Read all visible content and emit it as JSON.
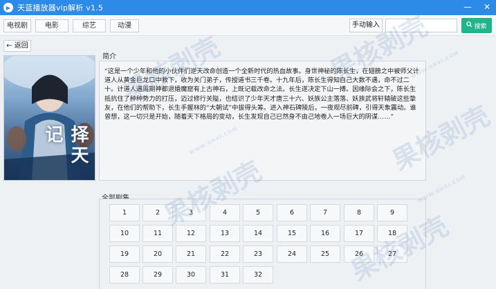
{
  "window": {
    "title": "天蓝播放器vip解析  v1.5",
    "minimize_glyph": "—",
    "close_glyph": "✕"
  },
  "toolbar": {
    "categories": [
      "电视剧",
      "电影",
      "综艺",
      "动漫"
    ],
    "manual_input_label": "手动输入",
    "search_value": "",
    "search_button_label": "搜索",
    "search_button_color": "#1fb489"
  },
  "nav": {
    "back_label": "← 返回"
  },
  "poster": {
    "title_glyphs": "择天记"
  },
  "intro": {
    "heading": "简介",
    "text": "“这是一个少年和他的小伙伴们逆天改命创造一个全新时代的热血故事。身世神秘的陈长生，在翅膀之中被师父计道人从黄金巨龙口中救下，收为关门弟子，传授道书三千卷。十九年后，陈长生得知自己大数不遇，命不过二十。计道人遇周期神都退婚魔窟有上古神石，上既记载改命之法。长生遂决定下山一搏。因缘际会之下，陈长生抵抗住了种种势力的打压，迈过修行关隘，也结识了少年天才唐三十六、妖族公主落落、妖族武将轩辕破这些挚友，在他们的帮助下，长生手握林的“大朝试”中拔得头筹。进入神石碑陵后，一夜观尽前碑，引得天象震动。谁曾想，这一切只是开始，随着天下格局的变动，长生发现自己已然身不由己地卷入一场巨大的阴谋……”"
  },
  "episodes": {
    "heading": "全部剧集",
    "items": [
      "1",
      "2",
      "3",
      "4",
      "5",
      "6",
      "7",
      "8",
      "9",
      "10",
      "11",
      "12",
      "13",
      "14",
      "15",
      "16",
      "17",
      "18",
      "19",
      "20",
      "21",
      "22",
      "23",
      "24",
      "25",
      "26",
      "27",
      "28",
      "29",
      "30",
      "31",
      "32"
    ]
  },
  "watermark": {
    "text": "果核剥壳",
    "url_text": "WWW.GHXI.COM"
  },
  "colors": {
    "titlebar": "#2c8be8",
    "accent": "#1fb489"
  }
}
